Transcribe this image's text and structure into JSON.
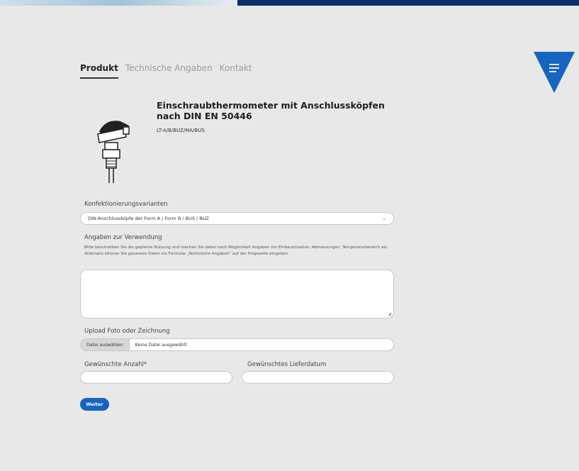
{
  "tabs": [
    {
      "label": "Produkt"
    },
    {
      "label": "Technische Angaben"
    },
    {
      "label": "Kontakt"
    }
  ],
  "product": {
    "title": "Einschraubthermometer mit Anschlussköpfen nach DIN EN 50446",
    "code": "LT-A/B/BUZ/MA/BUS"
  },
  "form": {
    "config_label": "Konfektionierungsvarianten",
    "config_value": "DIN-Anschlussköpfe der Form A / Form B / BUS / BUZ",
    "usage_label": "Angaben zur Verwendung",
    "usage_help_1": "Bitte beschreiben Sie die geplante Nutzung und machen Sie dabei nach Möglichkeit Angaben zur Einbausituation, Abmessungen, Temperaturbereich etc.",
    "usage_help_2": "Alternativ können Sie genauere Daten ins Formular „Technische Angaben“ auf der Folgeseite eingeben.",
    "upload_label": "Upload Foto oder Zeichnung",
    "upload_button": "Datei auswählen",
    "upload_status": "Keine Datei ausgewählt",
    "quantity_label": "Gewünschte Anzahl*",
    "date_label": "Gewünschtes Lieferdatum",
    "submit": "Weiter"
  },
  "colors": {
    "accent": "#1565c0",
    "menu": "#1565c0",
    "topbar": "#0f2f6b"
  }
}
